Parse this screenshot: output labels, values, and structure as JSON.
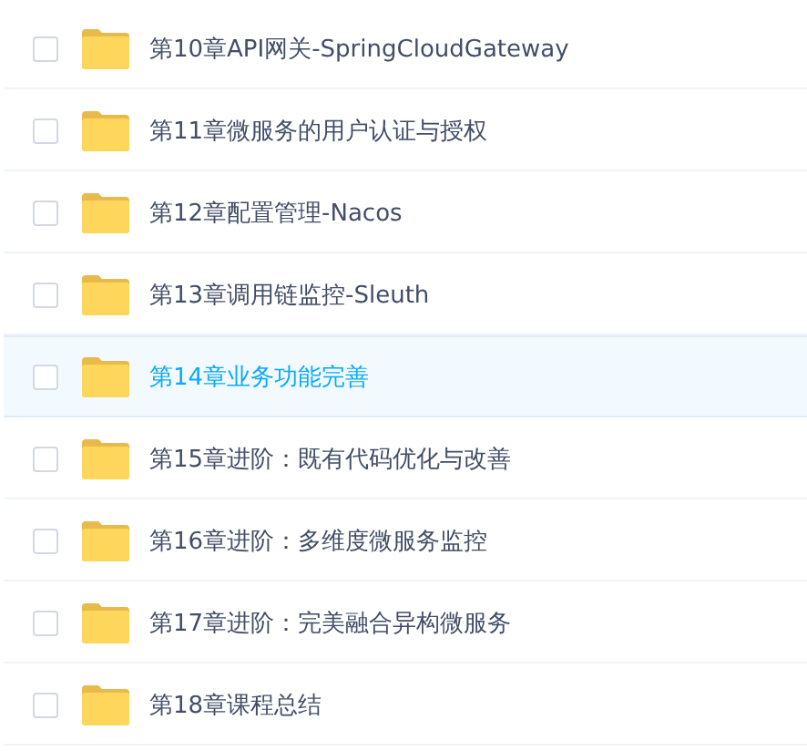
{
  "files": [
    {
      "name": "第10章API网关-SpringCloudGateway",
      "checked": false,
      "selected": false
    },
    {
      "name": "第11章微服务的用户认证与授权",
      "checked": false,
      "selected": false
    },
    {
      "name": "第12章配置管理-Nacos",
      "checked": false,
      "selected": false
    },
    {
      "name": "第13章调用链监控-Sleuth",
      "checked": false,
      "selected": false
    },
    {
      "name": "第14章业务功能完善",
      "checked": false,
      "selected": true
    },
    {
      "name": "第15章进阶：既有代码优化与改善",
      "checked": false,
      "selected": false
    },
    {
      "name": "第16章进阶：多维度微服务监控",
      "checked": false,
      "selected": false
    },
    {
      "name": "第17章进阶：完美融合异构微服务",
      "checked": false,
      "selected": false
    },
    {
      "name": "第18章课程总结",
      "checked": false,
      "selected": false
    }
  ]
}
